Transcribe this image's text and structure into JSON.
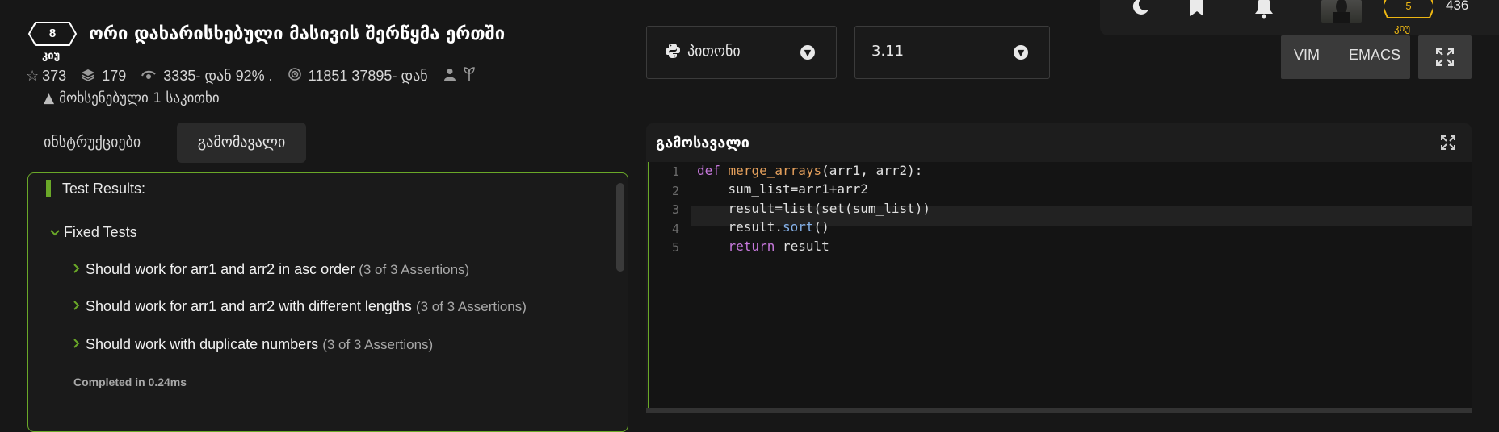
{
  "header": {
    "theme_icon": "moon-icon",
    "bookmark_icon": "bookmark-icon",
    "bell_icon": "bell-icon",
    "rank_number": "5",
    "rank_label": "კიუ",
    "honor": "436"
  },
  "kata": {
    "kyu_number": "8",
    "kyu_label": "კიუ",
    "title": "ორი დახარისხებული მასივის შერწყმა ერთში",
    "stats": {
      "stars": "373",
      "collections": "179",
      "satisfaction": "3335- დან 92% .",
      "completions": "11851 37895- დან"
    },
    "issue": "მოხსენებული 1 საკითხი"
  },
  "tabs": [
    {
      "label": "ინსტრუქციები",
      "active": false
    },
    {
      "label": "გამომავალი",
      "active": true
    }
  ],
  "results": {
    "title": "Test Results:",
    "group": "Fixed Tests",
    "tests": [
      {
        "name": "Should work for arr1 and arr2 in asc order",
        "assertions": "(3 of 3 Assertions)"
      },
      {
        "name": "Should work for arr1 and arr2 with different lengths",
        "assertions": "(3 of 3 Assertions)"
      },
      {
        "name": "Should work with duplicate numbers",
        "assertions": "(3 of 3 Assertions)"
      }
    ],
    "completed": "Completed in 0.24ms"
  },
  "language": {
    "selected": "პითონი",
    "icon": "python-icon"
  },
  "version": {
    "selected": "3.11"
  },
  "modes": {
    "vim": "VIM",
    "emacs": "EMACS"
  },
  "output_panel": {
    "title": "გამოსავალი",
    "code_lines": [
      {
        "num": "1",
        "text": "def merge_arrays(arr1, arr2):"
      },
      {
        "num": "2",
        "text": "    sum_list=arr1+arr2"
      },
      {
        "num": "3",
        "text": "    result=list(set(sum_list))"
      },
      {
        "num": "4",
        "text": "    result.sort()"
      },
      {
        "num": "5",
        "text": "    return result"
      }
    ]
  },
  "colors": {
    "accent_green": "#6aa828",
    "rank_yellow": "#ecb613",
    "background": "#171717"
  }
}
